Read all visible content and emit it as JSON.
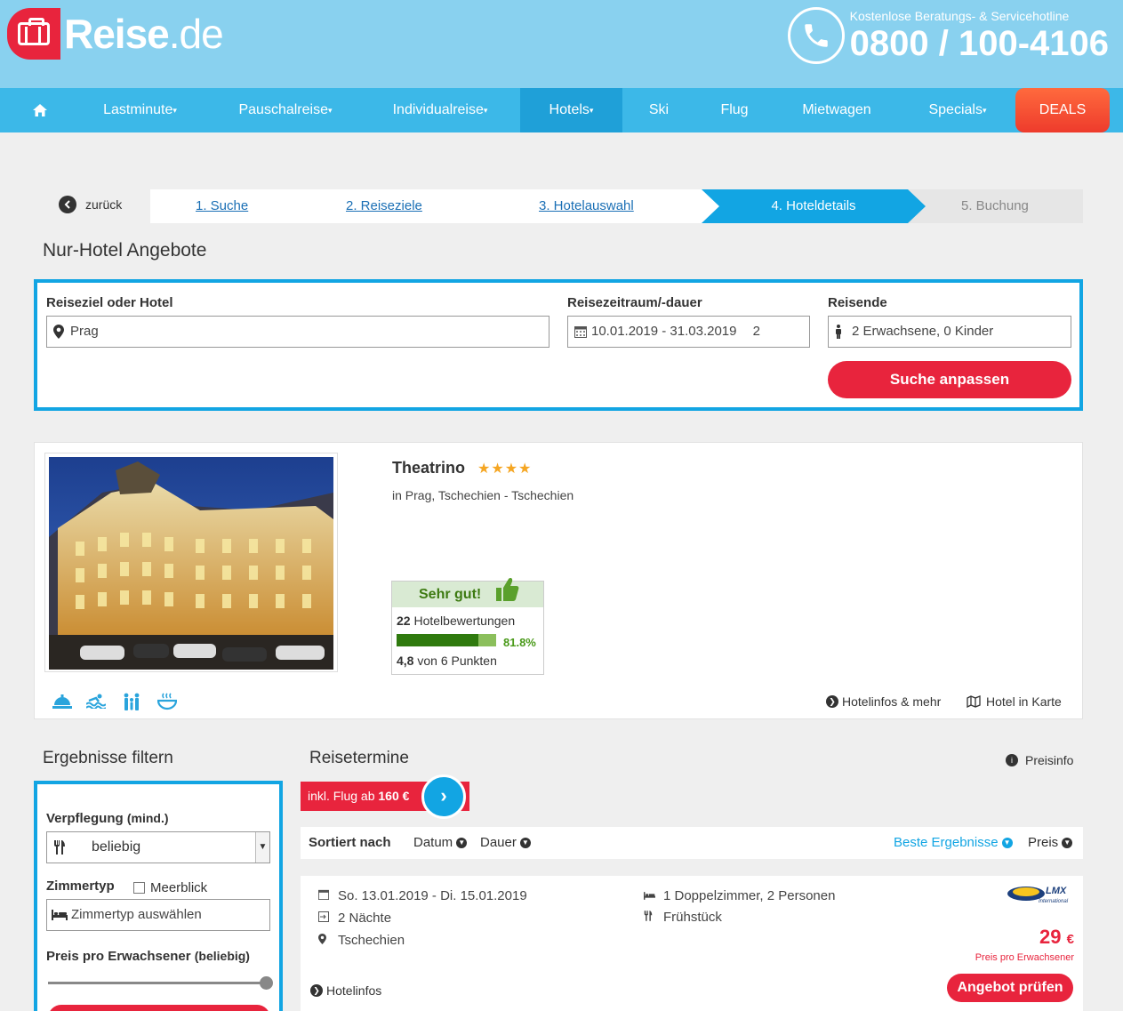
{
  "brand": {
    "name": "Reise",
    "tld": ".de"
  },
  "hotline": {
    "label": "Kostenlose Beratungs- & Servicehotline",
    "number": "0800 / 100-4106"
  },
  "nav": {
    "items": [
      {
        "label": "Lastminute",
        "caret": "▾"
      },
      {
        "label": "Pauschalreise",
        "caret": "▾"
      },
      {
        "label": "Individualreise",
        "caret": "▾"
      },
      {
        "label": "Hotels",
        "caret": "▾"
      },
      {
        "label": "Ski",
        "caret": ""
      },
      {
        "label": "Flug",
        "caret": ""
      },
      {
        "label": "Mietwagen",
        "caret": ""
      },
      {
        "label": "Specials",
        "caret": "▾"
      }
    ],
    "active": "Hotels",
    "deals": "DEALS"
  },
  "steps": {
    "back": "zurück",
    "items": [
      "1. Suche",
      "2. Reiseziele",
      "3. Hotelauswahl",
      "4. Hoteldetails",
      "5. Buchung"
    ]
  },
  "page_title": "Nur-Hotel Angebote",
  "search": {
    "destination_label": "Reiseziel oder Hotel",
    "destination_value": "Prag",
    "period_label": "Reisezeitraum/-dauer",
    "period_value": "10.01.2019 - 31.03.2019",
    "duration_value": "2",
    "travellers_label": "Reisende",
    "travellers_value": "2 Erwachsene, 0 Kinder",
    "submit": "Suche anpassen"
  },
  "hotel": {
    "name": "Theatrino",
    "stars": "★★★★",
    "location": "in Prag, Tschechien - Tschechien",
    "rating": {
      "verdict": "Sehr gut!",
      "reviews_count": "22",
      "reviews_label": "Hotelbewertungen",
      "percent": "81.8%",
      "percent_value": 0.818,
      "score": "4,8",
      "score_suffix": "von 6 Punkten"
    },
    "links": {
      "info": "Hotelinfos & mehr",
      "map": "Hotel in Karte"
    }
  },
  "filter": {
    "title": "Ergebnisse filtern",
    "board_label": "Verpflegung",
    "board_hint": "(mind.)",
    "board_value": "beliebig",
    "room_label": "Zimmertyp",
    "room_checkbox": "Meerblick",
    "room_placeholder": "Zimmertyp auswählen",
    "price_label": "Preis pro Erwachsener",
    "price_hint": "(beliebig)",
    "price_slider_value": 1.0
  },
  "results": {
    "title": "Reisetermine",
    "preisinfo": "Preisinfo",
    "flight_prefix": "inkl. Flug ab",
    "flight_price": "160 €",
    "sort_label": "Sortiert nach",
    "sort_options": [
      "Datum",
      "Dauer",
      "Beste Ergebnisse",
      "Preis"
    ],
    "offer": {
      "dates": "So. 13.01.2019 - Di. 15.01.2019",
      "nights": "2 Nächte",
      "country": "Tschechien",
      "room": "1 Doppelzimmer, 2 Personen",
      "board": "Frühstück",
      "operator": "LMX",
      "operator_sub": "International",
      "price": "29",
      "currency": "€",
      "price_sub": "Preis pro Erwachsener",
      "button": "Angebot prüfen",
      "info_link": "Hotelinfos"
    }
  },
  "colors": {
    "accent": "#12a5e3",
    "cta": "#e8243d",
    "header": "#89d1ef",
    "nav": "#3cb8e8"
  }
}
